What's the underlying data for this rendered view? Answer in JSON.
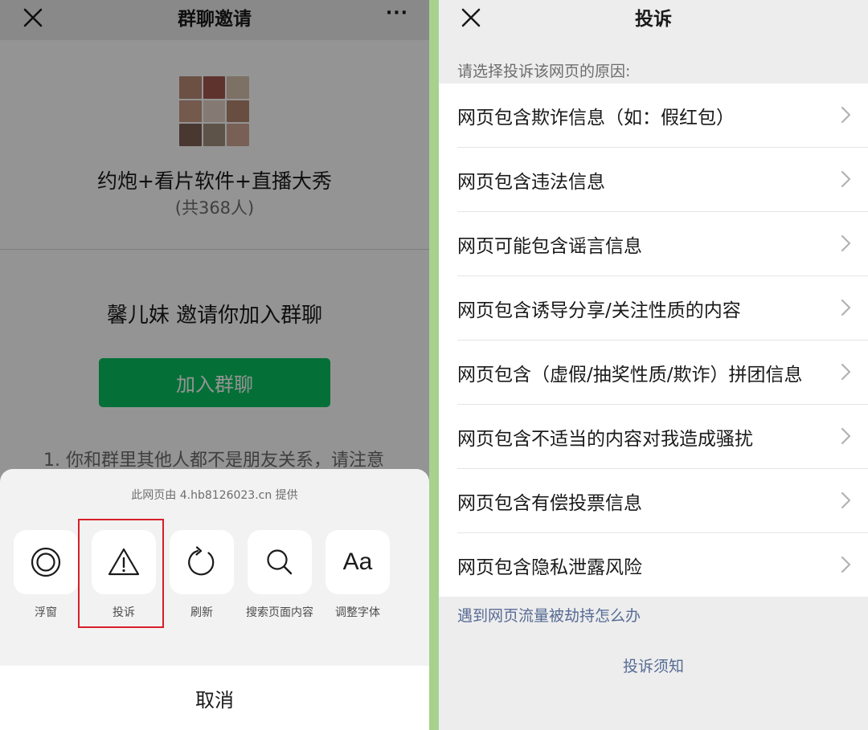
{
  "left": {
    "nav": {
      "title": "群聊邀请",
      "more": "···"
    },
    "group": {
      "name": "约炮+看片软件+直播大秀",
      "count": "(共368人)"
    },
    "invite_text": "馨儿妹 邀请你加入群聊",
    "join_label": "加入群聊",
    "note_text": "1. 你和群里其他人都不是朋友关系，请注意",
    "sheet": {
      "provider": "此网页由 4.hb8126023.cn 提供",
      "actions": [
        {
          "label": "浮窗",
          "icon": "float-window-icon"
        },
        {
          "label": "投诉",
          "icon": "warning-icon"
        },
        {
          "label": "刷新",
          "icon": "refresh-icon"
        },
        {
          "label": "搜索页面内容",
          "icon": "search-icon"
        },
        {
          "label": "调整字体",
          "icon": "font-size-icon",
          "glyph": "Aa"
        }
      ],
      "cancel_label": "取消"
    }
  },
  "right": {
    "nav": {
      "title": "投诉"
    },
    "prompt": "请选择投诉该网页的原因:",
    "reasons": [
      "网页包含欺诈信息（如：假红包）",
      "网页包含违法信息",
      "网页可能包含谣言信息",
      "网页包含诱导分享/关注性质的内容",
      "网页包含（虚假/抽奖性质/欺诈）拼团信息",
      "网页包含不适当的内容对我造成骚扰",
      "网页包含有偿投票信息",
      "网页包含隐私泄露风险"
    ],
    "hijack_link": "遇到网页流量被劫持怎么办",
    "notice_link": "投诉须知"
  },
  "colors": {
    "accent_green": "#07c160",
    "link_blue": "#576b95",
    "highlight_red": "#d81e2a",
    "divider_green": "#a8d18d"
  }
}
